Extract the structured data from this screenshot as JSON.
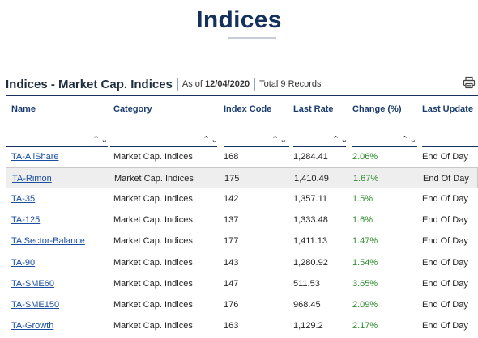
{
  "page": {
    "title": "Indices"
  },
  "section": {
    "title": "Indices - Market Cap. Indices",
    "as_of_label": "As of",
    "as_of_date": "12/04/2020",
    "records": "Total 9 Records"
  },
  "icons": {
    "print": "print-icon",
    "sort": "sort-up-down-icon"
  },
  "table": {
    "columns": [
      "Name",
      "Category",
      "Index Code",
      "Last Rate",
      "Change (%)",
      "Last Update"
    ],
    "rows": [
      [
        "TA-AllShare",
        "Market Cap. Indices",
        "168",
        "1,284.41",
        "2.06%",
        "End Of Day"
      ],
      [
        "TA-Rimon",
        "Market Cap. Indices",
        "175",
        "1,410.49",
        "1.67%",
        "End Of Day"
      ],
      [
        "TA-35",
        "Market Cap. Indices",
        "142",
        "1,357.11",
        "1.5%",
        "End Of Day"
      ],
      [
        "TA-125",
        "Market Cap. Indices",
        "137",
        "1,333.48",
        "1.6%",
        "End Of Day"
      ],
      [
        "TA Sector-Balance",
        "Market Cap. Indices",
        "177",
        "1,411.13",
        "1.47%",
        "End Of Day"
      ],
      [
        "TA-90",
        "Market Cap. Indices",
        "143",
        "1,280.92",
        "1.54%",
        "End Of Day"
      ],
      [
        "TA-SME60",
        "Market Cap. Indices",
        "147",
        "511.53",
        "3.65%",
        "End Of Day"
      ],
      [
        "TA-SME150",
        "Market Cap. Indices",
        "176",
        "968.45",
        "2.09%",
        "End Of Day"
      ],
      [
        "TA-Growth",
        "Market Cap. Indices",
        "163",
        "1,129.2",
        "2.17%",
        "End Of Day"
      ]
    ]
  },
  "colors": {
    "title": "#14305c",
    "link": "#1a4fa0",
    "positive": "#2e8b2e",
    "rule": "#16325c"
  }
}
